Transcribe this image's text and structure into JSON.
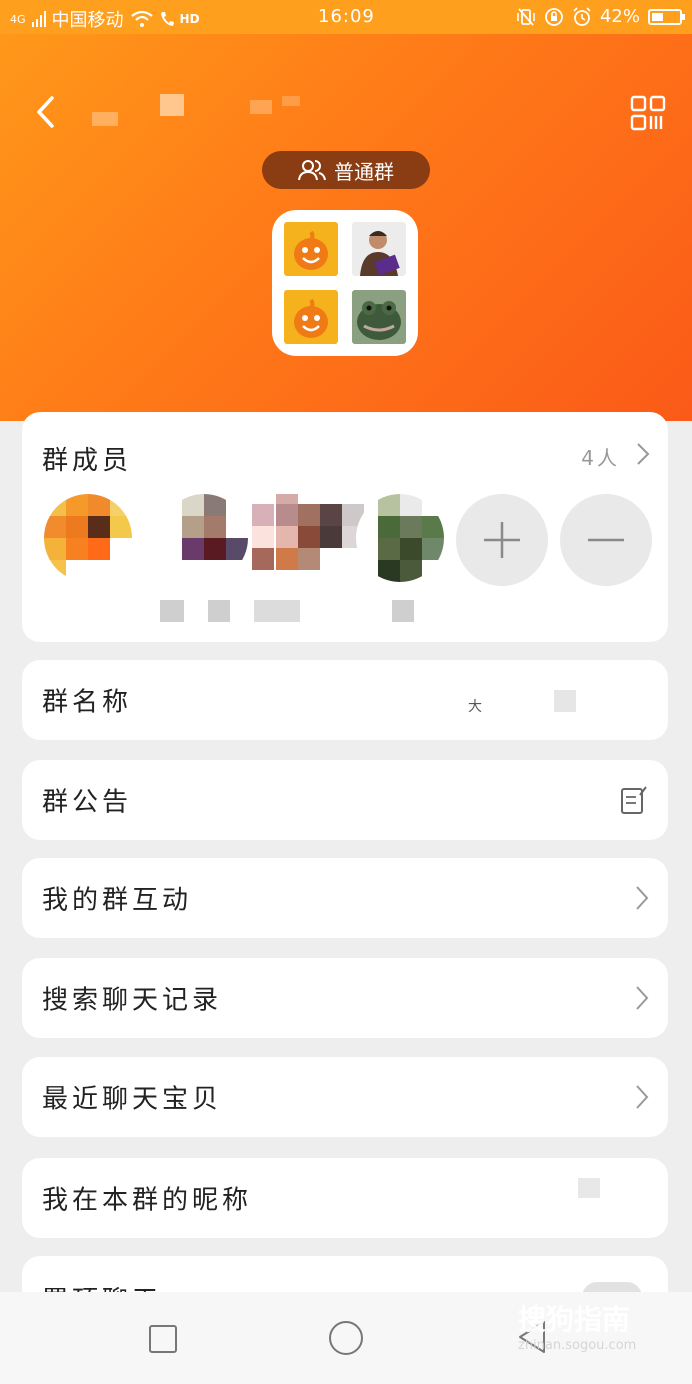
{
  "status_bar": {
    "network": "4G",
    "carrier": "中国移动",
    "hd": "HD",
    "time": "16:09",
    "battery": "42%",
    "battery_level": 0.42
  },
  "header": {
    "group_type": "普通群",
    "back_icon": "chevron-left-icon",
    "qr_icon": "qr-code-icon",
    "accent_color": "#ff7a18",
    "badge_color": "#8a3c12"
  },
  "members": {
    "title": "群成员",
    "count": "4人",
    "add_icon": "plus-icon",
    "remove_icon": "minus-icon"
  },
  "rows": {
    "group_name": "群名称",
    "group_name_value": "大",
    "announcement": "群公告",
    "my_interaction": "我的群互动",
    "search_history": "搜索聊天记录",
    "recent_items": "最近聊天宝贝",
    "my_nickname": "我在本群的昵称",
    "partial_next": "置顶聊天"
  },
  "watermark": {
    "main": "搜狗指南",
    "sub": "zhinan.sogou.com"
  }
}
